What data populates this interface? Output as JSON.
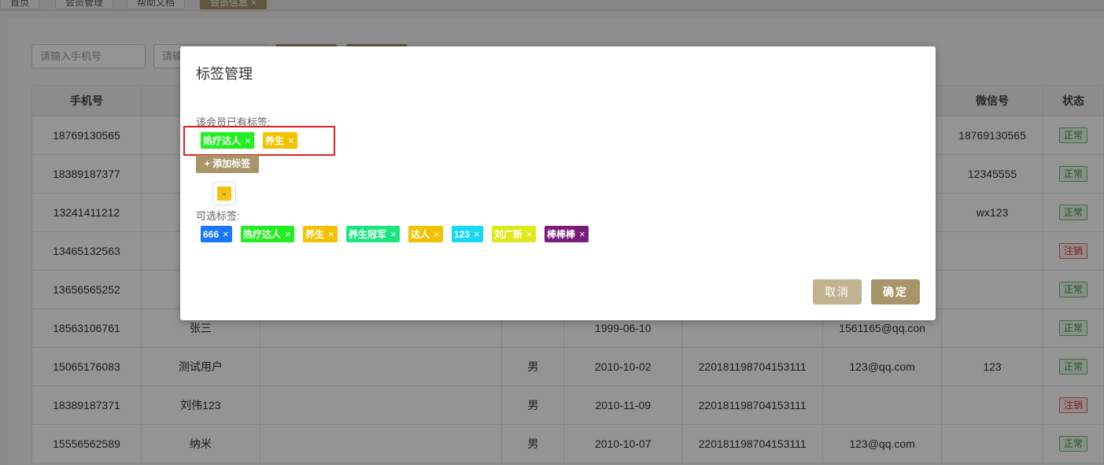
{
  "tabs": [
    {
      "label": "首页"
    },
    {
      "label": "会员管理"
    },
    {
      "label": "帮助文档"
    },
    {
      "label": "会员信息",
      "close": "×"
    }
  ],
  "search": {
    "phone_placeholder": "请输入手机号",
    "second_placeholder": "请输"
  },
  "table": {
    "headers": [
      "手机号",
      "",
      "",
      "",
      "",
      "",
      "",
      "微信号",
      "状态"
    ],
    "rows": [
      {
        "phone": "18769130565",
        "name": "",
        "gender": "",
        "birthday": "",
        "id_no": "",
        "email": "",
        "wechat": "18769130565",
        "status": "正常",
        "status_type": "normal"
      },
      {
        "phone": "18389187377",
        "name": "",
        "gender": "",
        "birthday": "",
        "id_no": "",
        "email": "",
        "wechat": "12345555",
        "status": "正常",
        "status_type": "normal"
      },
      {
        "phone": "13241411212",
        "name": "",
        "gender": "",
        "birthday": "",
        "id_no": "",
        "email": "",
        "wechat": "wx123",
        "status": "正常",
        "status_type": "normal"
      },
      {
        "phone": "13465132563",
        "name": "",
        "gender": "",
        "birthday": "",
        "id_no": "",
        "email": "",
        "wechat": "",
        "status": "注销",
        "status_type": "cancelled"
      },
      {
        "phone": "13656565252",
        "name": "",
        "gender": "",
        "birthday": "",
        "id_no": "",
        "email": "",
        "wechat": "",
        "status": "正常",
        "status_type": "normal"
      },
      {
        "phone": "18563106761",
        "name": "张三",
        "gender": "",
        "birthday": "1999-06-10",
        "id_no": "",
        "email": "1561165@qq.con",
        "wechat": "",
        "status": "正常",
        "status_type": "normal"
      },
      {
        "phone": "15065176083",
        "name": "测试用户",
        "gender": "男",
        "birthday": "2010-10-02",
        "id_no": "220181198704153111",
        "email": "123@qq.com",
        "wechat": "123",
        "status": "正常",
        "status_type": "normal"
      },
      {
        "phone": "18389187371",
        "name": "刘伟123",
        "gender": "男",
        "birthday": "2010-11-09",
        "id_no": "220181198704153111",
        "email": "",
        "wechat": "",
        "status": "注销",
        "status_type": "cancelled"
      },
      {
        "phone": "15556562589",
        "name": "纳米",
        "gender": "男",
        "birthday": "2010-10-07",
        "id_no": "220181198704153111",
        "email": "123@qq.com",
        "wechat": "",
        "status": "正常",
        "status_type": "normal"
      }
    ]
  },
  "dialog": {
    "title": "标签管理",
    "owned_label": "该会员已有标签:",
    "owned_tags": [
      {
        "label": "热疗达人",
        "color": "#22ee22"
      },
      {
        "label": "养生",
        "color": "#f2c200"
      }
    ],
    "add_tag_label": "+ 添加标签",
    "available_label": "可选标签:",
    "available_tags": [
      {
        "label": "666",
        "color": "#1677ff"
      },
      {
        "label": "热疗达人",
        "color": "#22ee22"
      },
      {
        "label": "养生",
        "color": "#f2c200"
      },
      {
        "label": "养生冠军",
        "color": "#19e680"
      },
      {
        "label": "达人",
        "color": "#f2c200"
      },
      {
        "label": "123",
        "color": "#17d8f5"
      },
      {
        "label": "刘广新",
        "color": "#dfe81a"
      },
      {
        "label": "棒棒棒",
        "color": "#7a1a7a"
      }
    ],
    "close_glyph": "×",
    "color_picker_icon": "chevron-down-icon",
    "color_picker_glyph": "⌄",
    "cancel_label": "取消",
    "confirm_label": "确定",
    "accent_color": "#a8966a"
  }
}
